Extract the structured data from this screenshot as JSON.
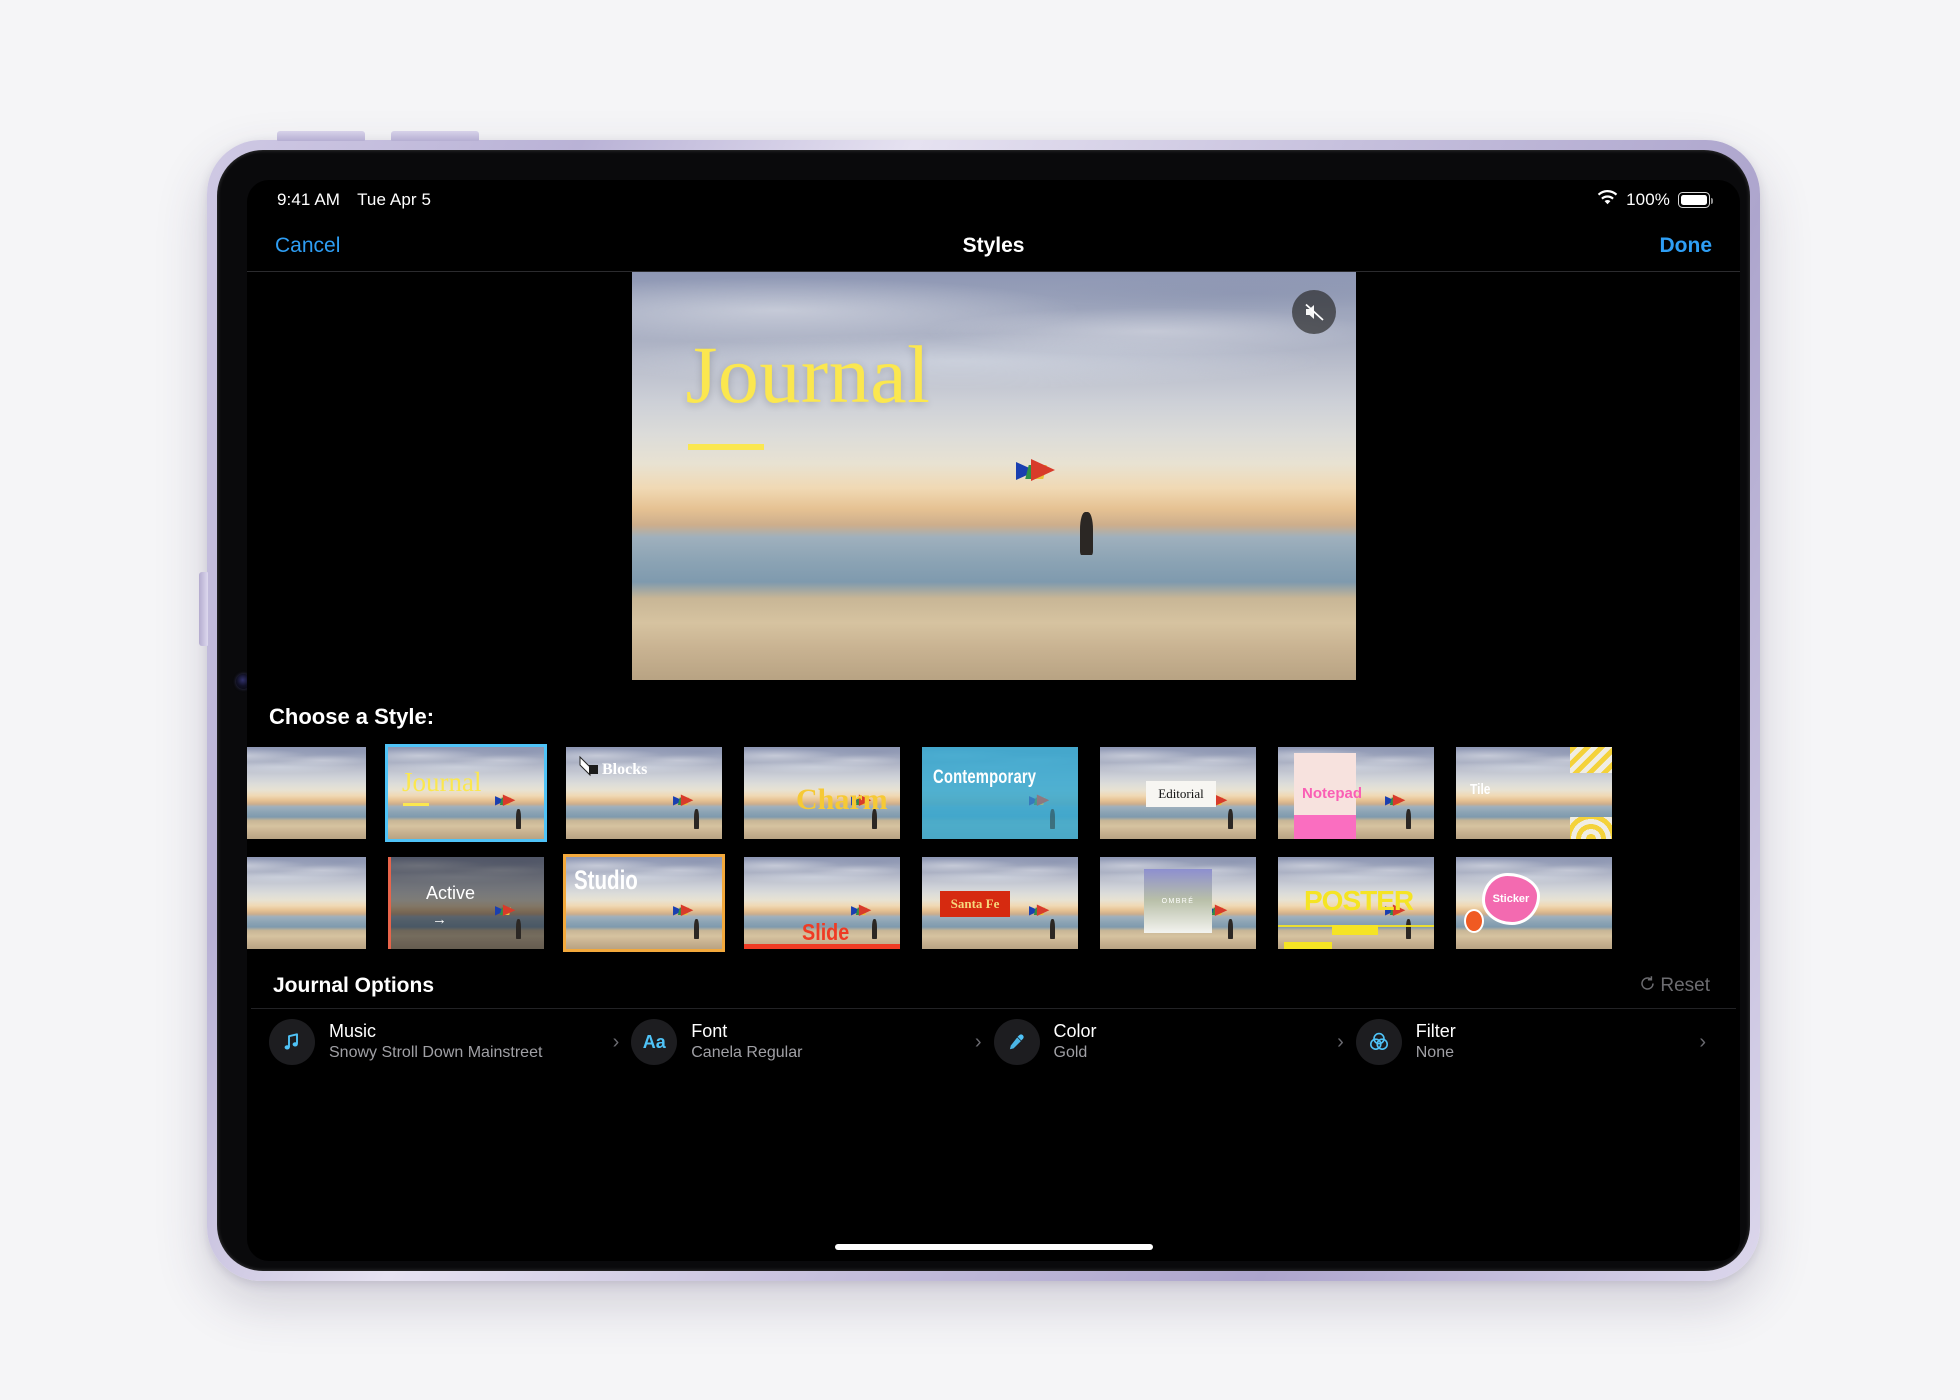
{
  "status_bar": {
    "time": "9:41 AM",
    "date": "Tue Apr 5",
    "battery_percent": "100%",
    "wifi_icon": "wifi-icon",
    "battery_icon": "battery-full-icon"
  },
  "nav": {
    "cancel_label": "Cancel",
    "title": "Styles",
    "done_label": "Done"
  },
  "preview": {
    "title": "Journal",
    "mute_icon": "speaker-mute-icon"
  },
  "style_picker": {
    "heading": "Choose a Style:",
    "row1": [
      {
        "name": "",
        "partial": true
      },
      {
        "name": "Journal",
        "selected": true
      },
      {
        "name": "Blocks"
      },
      {
        "name": "Charm"
      },
      {
        "name": "Contemporary"
      },
      {
        "name": "Editorial"
      },
      {
        "name": "Notepad"
      },
      {
        "name": "Tile",
        "partial": true
      }
    ],
    "row2": [
      {
        "name": "",
        "partial": true
      },
      {
        "name": "Active"
      },
      {
        "name": "Studio",
        "selected": true
      },
      {
        "name": "Slide"
      },
      {
        "name": "Santa Fe"
      },
      {
        "name": "OMBRÉ"
      },
      {
        "name": "POSTER"
      },
      {
        "name": "Sticker",
        "partial": true
      }
    ]
  },
  "options": {
    "title": "Journal Options",
    "reset_label": "Reset",
    "reset_icon": "reset-circular-arrow-icon",
    "items": [
      {
        "label": "Music",
        "value": "Snowy Stroll Down Mainstreet",
        "icon": "music-note-icon"
      },
      {
        "label": "Font",
        "value": "Canela Regular",
        "icon": "aa-text-icon"
      },
      {
        "label": "Color",
        "value": "Gold",
        "icon": "eyedropper-icon"
      },
      {
        "label": "Filter",
        "value": "None",
        "icon": "filter-circles-icon"
      }
    ],
    "chevron": "›"
  },
  "colors": {
    "accent_blue": "#2e9ef4",
    "selection_blue": "#4fc3f7",
    "selection_orange": "#f3a93c",
    "title_yellow": "#fbe74f",
    "icon_blue": "#4fc3f7",
    "device_body": "#c6c0dd"
  }
}
